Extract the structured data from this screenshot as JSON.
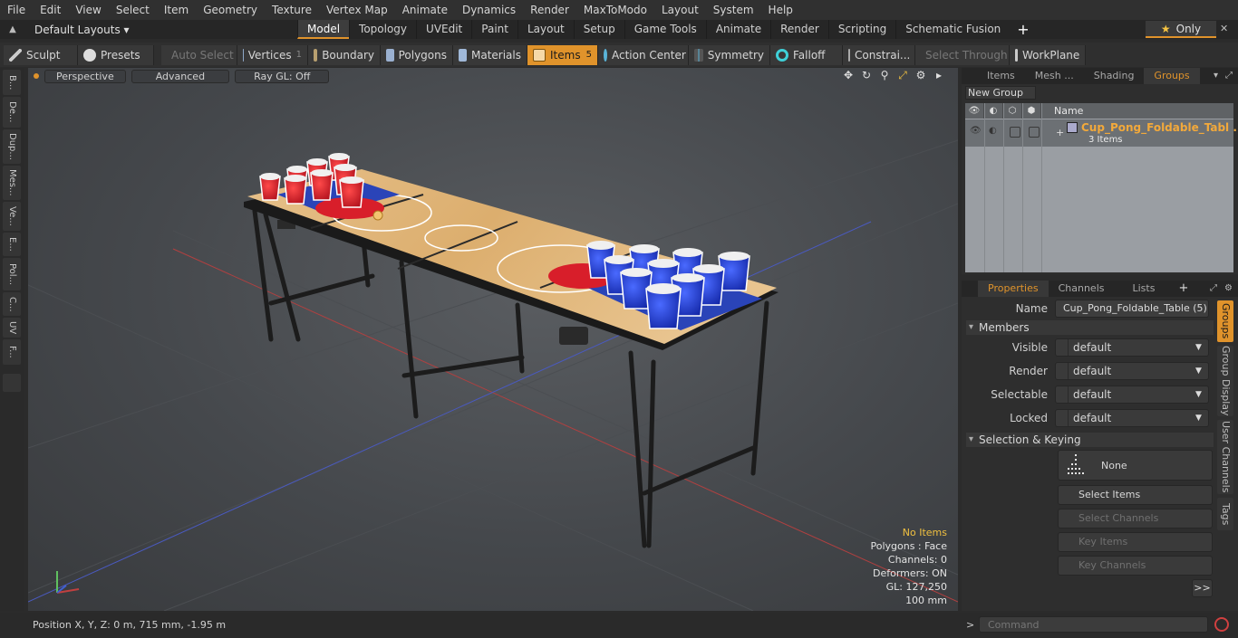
{
  "menu": [
    "File",
    "Edit",
    "View",
    "Select",
    "Item",
    "Geometry",
    "Texture",
    "Vertex Map",
    "Animate",
    "Dynamics",
    "Render",
    "MaxToModo",
    "Layout",
    "System",
    "Help"
  ],
  "layout": {
    "dropdown": "Default Layouts ▾",
    "tabs": [
      "Model",
      "Topology",
      "UVEdit",
      "Paint",
      "Layout",
      "Setup",
      "Game Tools",
      "Animate",
      "Render",
      "Scripting",
      "Schematic Fusion"
    ],
    "add": "+",
    "only": "Only"
  },
  "toolbar": {
    "sculpt": "Sculpt",
    "presets": "Presets",
    "auto_select": "Auto Select",
    "vertices": "Vertices",
    "vertices_count": "1",
    "boundary": "Boundary",
    "polygons": "Polygons",
    "materials": "Materials",
    "items": "Items",
    "items_count": "5",
    "action_center": "Action Center",
    "symmetry": "Symmetry",
    "falloff": "Falloff",
    "constraints": "Constrai...",
    "select_through": "Select Through",
    "workplane": "WorkPlane"
  },
  "left_tabs": [
    "B...",
    "De...",
    "Dup...",
    "Mes...",
    "Ve...",
    "E...",
    "Pol...",
    "C...",
    "UV",
    "F..."
  ],
  "viewport": {
    "perspective": "Perspective",
    "advanced": "Advanced",
    "raygl": "Ray GL: Off",
    "info": {
      "no_items": "No Items",
      "polygons": "Polygons : Face",
      "channels": "Channels: 0",
      "deformers": "Deformers: ON",
      "gl": "GL: 127,250",
      "scale": "100 mm"
    }
  },
  "groups_panel": {
    "tabs": [
      "Items",
      "Mesh ...",
      "Shading",
      "Groups"
    ],
    "new_group": "New Group",
    "name_header": "Name",
    "group_name": "Cup_Pong_Foldable_Tabl ...",
    "group_sub": "3 Items"
  },
  "properties_panel": {
    "tabs": [
      "Properties",
      "Channels",
      "Lists"
    ],
    "name_label": "Name",
    "name_value": "Cup_Pong_Foldable_Table (5)",
    "members_section": "Members",
    "visible_label": "Visible",
    "visible_value": "default",
    "render_label": "Render",
    "render_value": "default",
    "selectable_label": "Selectable",
    "selectable_value": "default",
    "locked_label": "Locked",
    "locked_value": "default",
    "selection_section": "Selection & Keying",
    "none_label": "None",
    "select_items": "Select Items",
    "select_channels": "Select Channels",
    "key_items": "Key Items",
    "key_channels": "Key Channels",
    "more": ">>"
  },
  "right_tabs": [
    "Groups",
    "Group Display",
    "User Channels",
    "Tags"
  ],
  "status": {
    "position": "Position X, Y, Z:   0 m, 715 mm, -1.95 m",
    "command_placeholder": "Command"
  },
  "colors": {
    "accent": "#e0932b",
    "red_cup": "#d81e2a",
    "blue_cup": "#1f3fd6",
    "wood": "#e0b779"
  }
}
